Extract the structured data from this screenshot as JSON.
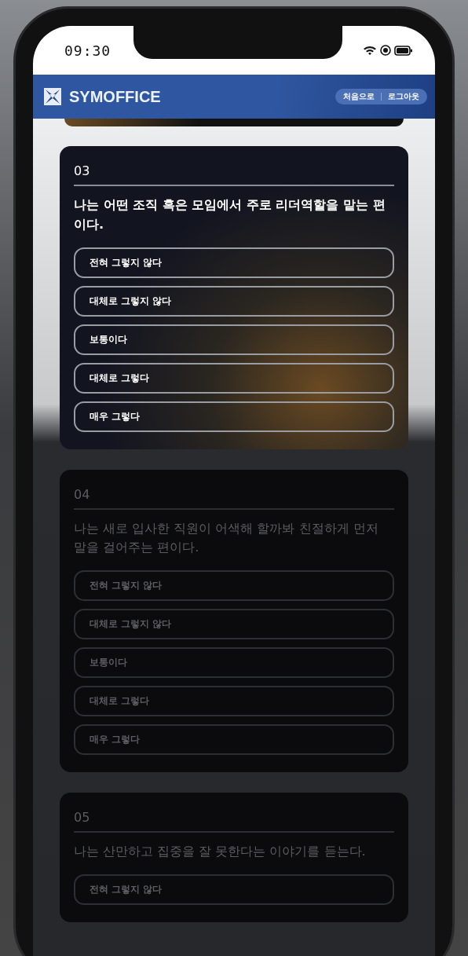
{
  "status_bar": {
    "time": "09:30"
  },
  "header": {
    "brand": "SYMOFFICE",
    "links": [
      "처음으로",
      "로그아웃"
    ]
  },
  "questions": [
    {
      "number": "03",
      "text": "나는 어떤 조직 혹은 모임에서 주로 리더역할을 맡는 편이다.",
      "dimmed": false,
      "options": [
        "전혀 그렇지 않다",
        "대체로 그렇지 않다",
        "보통이다",
        "대체로 그렇다",
        "매우 그렇다"
      ]
    },
    {
      "number": "04",
      "text": "나는 새로 입사한 직원이 어색해 할까봐 친절하게 먼저 말을 걸어주는 편이다.",
      "dimmed": true,
      "options": [
        "전혀 그렇지 않다",
        "대체로 그렇지 않다",
        "보통이다",
        "대체로 그렇다",
        "매우 그렇다"
      ]
    },
    {
      "number": "05",
      "text": "나는 산만하고 집중을 잘 못한다는 이야기를 듣는다.",
      "dimmed": true,
      "options": [
        "전혀 그렇지 않다"
      ]
    }
  ]
}
